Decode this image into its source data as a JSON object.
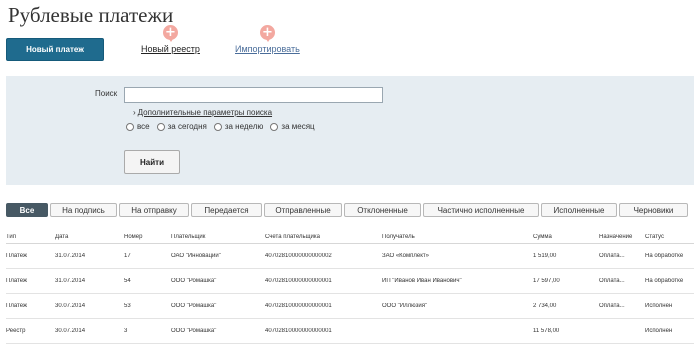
{
  "page_title": "Рублевые платежи",
  "actions": {
    "new_payment": "Новый платеж",
    "new_registry": "Новый реестр",
    "import": "Импортировать",
    "plus_icon": "+"
  },
  "search": {
    "label": "Поиск",
    "value": "",
    "advanced_link": "Дополнительные параметры поиска",
    "chevron": "›",
    "period_options": [
      "все",
      "за сегодня",
      "за неделю",
      "за месяц"
    ],
    "find_button": "Найти"
  },
  "tabs": [
    "Все",
    "На подпись",
    "На отправку",
    "Передается",
    "Отправленные",
    "Отклоненные",
    "Частично исполненные",
    "Исполненные",
    "Черновики"
  ],
  "table": {
    "columns": [
      "Тип",
      "Дата",
      "Номер",
      "Плательщик",
      "Счета плательщика",
      "Получатель",
      "Сумма",
      "Назначение",
      "Статус"
    ],
    "rows": [
      [
        "Платеж",
        "31.07.2014",
        "17",
        "ОАО \"Инновации\"",
        "40702810000000000002",
        "ЗАО «Комплект»",
        "1 519,00",
        "Оплата...",
        "На обработке"
      ],
      [
        "Платеж",
        "31.07.2014",
        "54",
        "ООО \"Ромашка\"",
        "40702810000000000001",
        "ИП \"Иванов Иван Иванович\"",
        "17 597,00",
        "Оплата...",
        "На обработке"
      ],
      [
        "Платеж",
        "30.07.2014",
        "53",
        "ООО \"Ромашка\"",
        "40702810000000000001",
        "ООО \"Иллюзия\"",
        "2 734,00",
        "Оплата...",
        "Исполнен"
      ],
      [
        "Реестр",
        "30.07.2014",
        "3",
        "ООО \"Ромашка\"",
        "40702810000000000001",
        "",
        "11 578,00",
        "",
        "Исполнен"
      ]
    ]
  }
}
